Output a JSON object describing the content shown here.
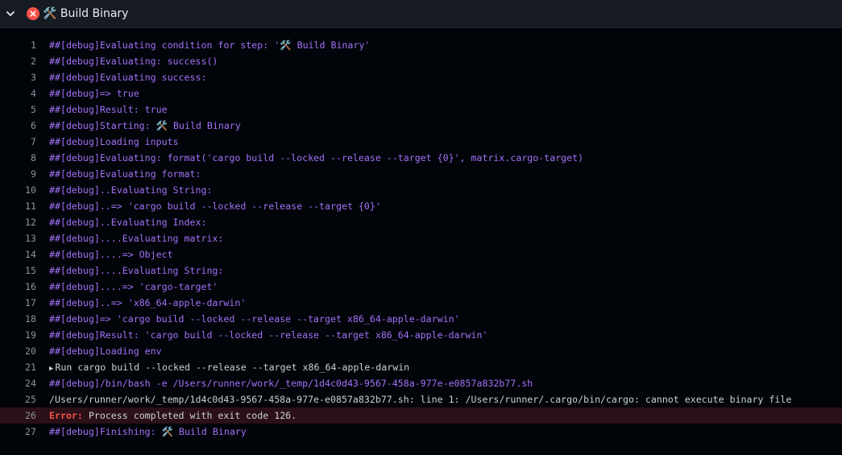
{
  "header": {
    "title": "🛠️ Build Binary",
    "colors": {
      "failure": "#f85149"
    },
    "expand_icon": "chevron-down-icon",
    "status_icon": "failure-x-circle-icon"
  },
  "colors": {
    "debug": "#a371f7",
    "plain": "#c9d1d9",
    "error": "#f85149",
    "error_row_bg": "#2b1017"
  },
  "lines": [
    {
      "n": "1",
      "t": "##[debug]Evaluating condition for step: '🛠️ Build Binary'"
    },
    {
      "n": "2",
      "t": "##[debug]Evaluating: success()"
    },
    {
      "n": "3",
      "t": "##[debug]Evaluating success:"
    },
    {
      "n": "4",
      "t": "##[debug]=> true"
    },
    {
      "n": "5",
      "t": "##[debug]Result: true"
    },
    {
      "n": "6",
      "t": "##[debug]Starting: 🛠️ Build Binary"
    },
    {
      "n": "7",
      "t": "##[debug]Loading inputs"
    },
    {
      "n": "8",
      "t": "##[debug]Evaluating: format('cargo build --locked --release --target {0}', matrix.cargo-target)"
    },
    {
      "n": "9",
      "t": "##[debug]Evaluating format:"
    },
    {
      "n": "10",
      "t": "##[debug]..Evaluating String:"
    },
    {
      "n": "11",
      "t": "##[debug]..=> 'cargo build --locked --release --target {0}'"
    },
    {
      "n": "12",
      "t": "##[debug]..Evaluating Index:"
    },
    {
      "n": "13",
      "t": "##[debug]....Evaluating matrix:"
    },
    {
      "n": "14",
      "t": "##[debug]....=> Object"
    },
    {
      "n": "15",
      "t": "##[debug]....Evaluating String:"
    },
    {
      "n": "16",
      "t": "##[debug]....=> 'cargo-target'"
    },
    {
      "n": "17",
      "t": "##[debug]..=> 'x86_64-apple-darwin'"
    },
    {
      "n": "18",
      "t": "##[debug]=> 'cargo build --locked --release --target x86_64-apple-darwin'"
    },
    {
      "n": "19",
      "t": "##[debug]Result: 'cargo build --locked --release --target x86_64-apple-darwin'"
    },
    {
      "n": "20",
      "t": "##[debug]Loading env"
    },
    {
      "n": "21",
      "t": "Run cargo build --locked --release --target x86_64-apple-darwin",
      "group": true
    },
    {
      "n": "24",
      "t": "##[debug]/bin/bash -e /Users/runner/work/_temp/1d4c0d43-9567-458a-977e-e0857a832b77.sh"
    },
    {
      "n": "25",
      "t": "/Users/runner/work/_temp/1d4c0d43-9567-458a-977e-e0857a832b77.sh: line 1: /Users/runner/.cargo/bin/cargo: cannot execute binary file",
      "plain": true
    },
    {
      "n": "26",
      "label": "Error:",
      "t": " Process completed with exit code 126.",
      "error": true
    },
    {
      "n": "27",
      "t": "##[debug]Finishing: 🛠️ Build Binary"
    }
  ]
}
